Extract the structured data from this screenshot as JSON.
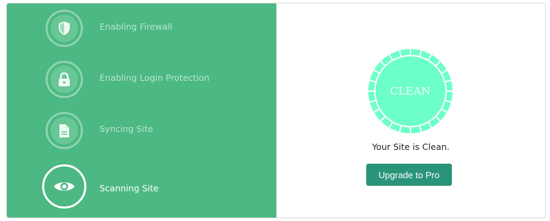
{
  "steps": [
    {
      "label": "Enabling Firewall",
      "icon": "shield-icon",
      "state": "done"
    },
    {
      "label": "Enabling Login Protection",
      "icon": "lock-icon",
      "state": "done"
    },
    {
      "label": "Syncing Site",
      "icon": "document-icon",
      "state": "done"
    },
    {
      "label": "Scanning Site",
      "icon": "eye-icon",
      "state": "active"
    }
  ],
  "result": {
    "badge_text": "CLEAN",
    "status_text": "Your Site is Clean.",
    "button_label": "Upgrade to Pro"
  },
  "colors": {
    "panel": "#4cb883",
    "ring": "#6dffc8",
    "button": "#2a9478"
  }
}
